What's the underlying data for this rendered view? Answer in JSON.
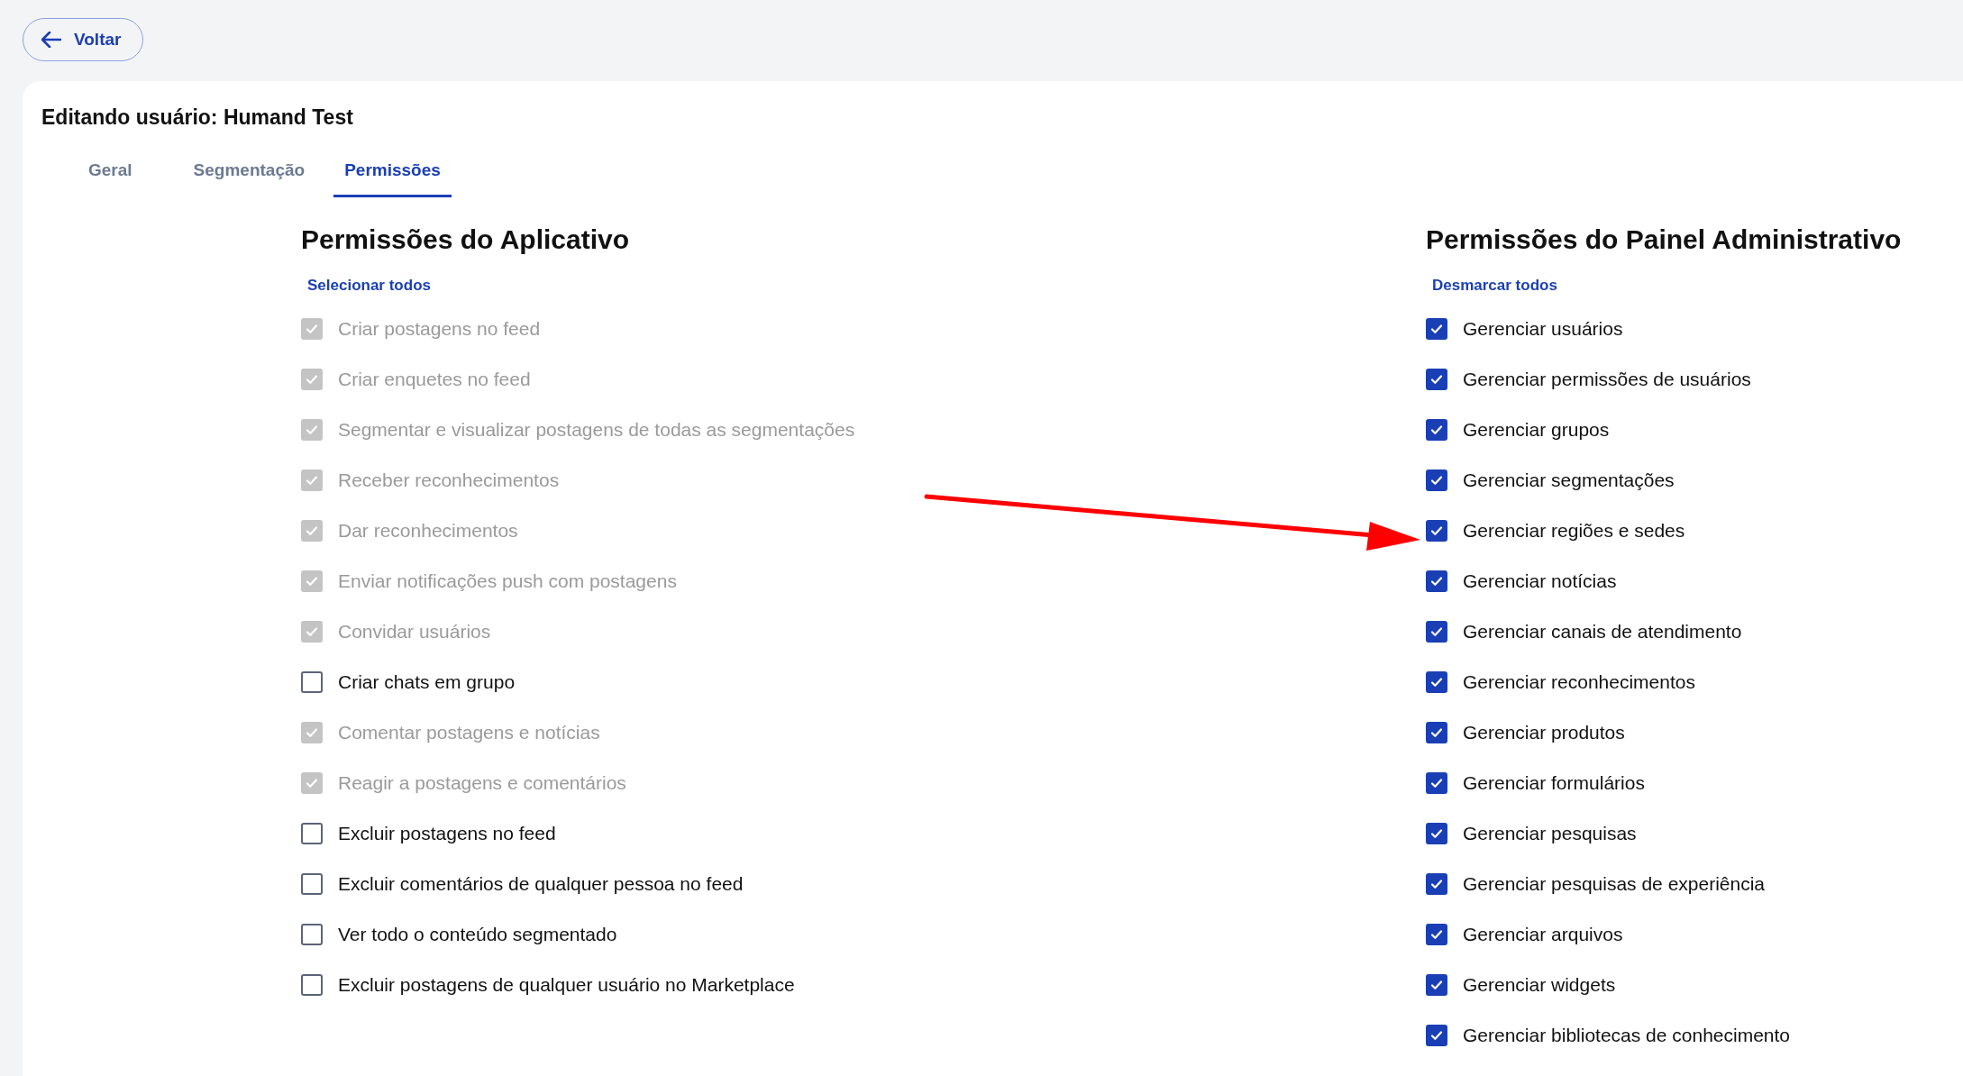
{
  "back_button": {
    "label": "Voltar"
  },
  "title": "Editando usuário: Humand Test",
  "tabs": [
    {
      "label": "Geral",
      "selected": false
    },
    {
      "label": "Segmentação",
      "selected": false
    },
    {
      "label": "Permissões",
      "selected": true
    }
  ],
  "sections": [
    {
      "heading": "Permissões do Aplicativo",
      "toggle_all": "Selecionar todos",
      "items": [
        {
          "label": "Criar postagens no feed",
          "checked": true,
          "disabled": true
        },
        {
          "label": "Criar enquetes no feed",
          "checked": true,
          "disabled": true
        },
        {
          "label": "Segmentar e visualizar postagens de todas as segmentações",
          "checked": true,
          "disabled": true
        },
        {
          "label": "Receber reconhecimentos",
          "checked": true,
          "disabled": true
        },
        {
          "label": "Dar reconhecimentos",
          "checked": true,
          "disabled": true
        },
        {
          "label": "Enviar notificações push com postagens",
          "checked": true,
          "disabled": true
        },
        {
          "label": "Convidar usuários",
          "checked": true,
          "disabled": true
        },
        {
          "label": "Criar chats em grupo",
          "checked": false,
          "disabled": false
        },
        {
          "label": "Comentar postagens e notícias",
          "checked": true,
          "disabled": true
        },
        {
          "label": "Reagir a postagens e comentários",
          "checked": true,
          "disabled": true
        },
        {
          "label": "Excluir postagens no feed",
          "checked": false,
          "disabled": false
        },
        {
          "label": "Excluir comentários de qualquer pessoa no feed",
          "checked": false,
          "disabled": false
        },
        {
          "label": "Ver todo o conteúdo segmentado",
          "checked": false,
          "disabled": false
        },
        {
          "label": "Excluir postagens de qualquer usuário no Marketplace",
          "checked": false,
          "disabled": false
        }
      ]
    },
    {
      "heading": "Permissões do Painel Administrativo",
      "toggle_all": "Desmarcar todos",
      "items": [
        {
          "label": "Gerenciar usuários",
          "checked": true,
          "disabled": false
        },
        {
          "label": "Gerenciar permissões de usuários",
          "checked": true,
          "disabled": false
        },
        {
          "label": "Gerenciar grupos",
          "checked": true,
          "disabled": false
        },
        {
          "label": "Gerenciar segmentações",
          "checked": true,
          "disabled": false
        },
        {
          "label": "Gerenciar regiões e sedes",
          "checked": true,
          "disabled": false
        },
        {
          "label": "Gerenciar notícias",
          "checked": true,
          "disabled": false
        },
        {
          "label": "Gerenciar canais de atendimento",
          "checked": true,
          "disabled": false
        },
        {
          "label": "Gerenciar reconhecimentos",
          "checked": true,
          "disabled": false
        },
        {
          "label": "Gerenciar produtos",
          "checked": true,
          "disabled": false
        },
        {
          "label": "Gerenciar formulários",
          "checked": true,
          "disabled": false
        },
        {
          "label": "Gerenciar pesquisas",
          "checked": true,
          "disabled": false
        },
        {
          "label": "Gerenciar pesquisas de experiência",
          "checked": true,
          "disabled": false
        },
        {
          "label": "Gerenciar arquivos",
          "checked": true,
          "disabled": false
        },
        {
          "label": "Gerenciar widgets",
          "checked": true,
          "disabled": false
        },
        {
          "label": "Gerenciar bibliotecas de conhecimento",
          "checked": true,
          "disabled": false
        }
      ]
    }
  ],
  "annotation": {
    "kind": "arrow"
  }
}
